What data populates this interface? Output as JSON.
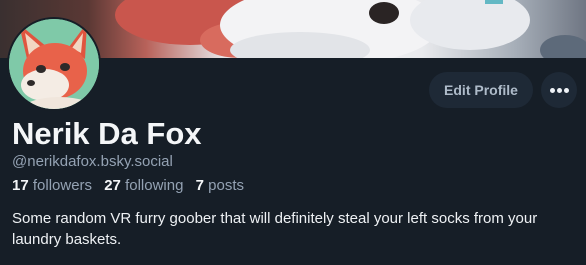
{
  "profile": {
    "display_name": "Nerik Da Fox",
    "handle": "@nerikdafox.bsky.social",
    "bio": "Some random VR furry goober that will definitely steal your left socks from your laundry baskets.",
    "stats": {
      "followers_count": "17",
      "followers_label": "followers",
      "following_count": "27",
      "following_label": "following",
      "posts_count": "7",
      "posts_label": "posts"
    }
  },
  "actions": {
    "edit_profile_label": "Edit Profile",
    "more_icon": "ellipsis-icon"
  },
  "colors": {
    "background": "#161e27",
    "button_bg": "#1e2936",
    "muted_text": "#94a2b3",
    "primary_text": "#f4f6f8"
  }
}
